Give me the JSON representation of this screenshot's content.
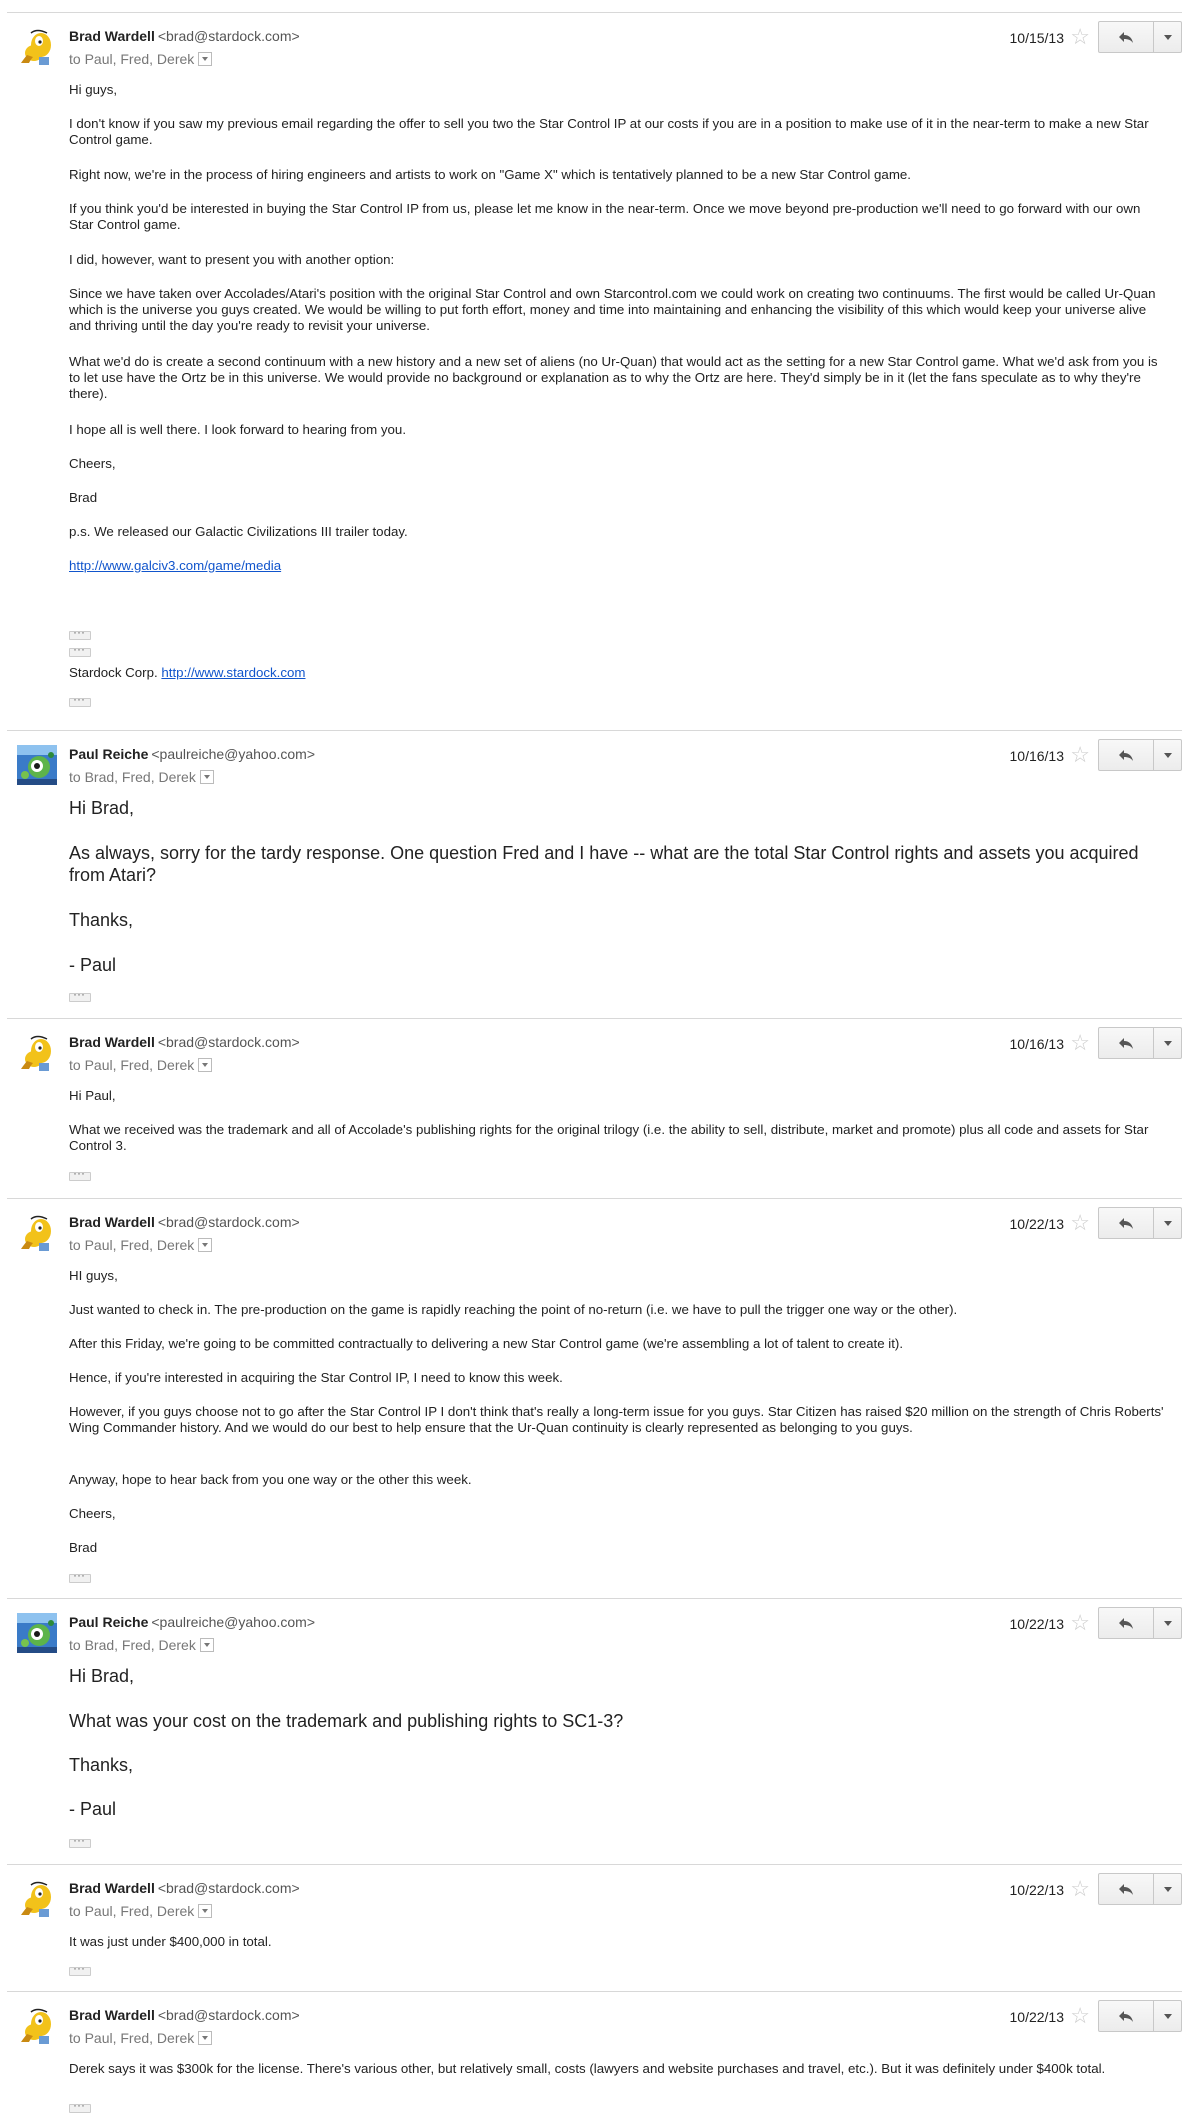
{
  "thread": {
    "messages": [
      {
        "sender": "Brad Wardell",
        "email": "<brad@stardock.com>",
        "to": "to Paul, Fred, Derek",
        "date": "10/15/13",
        "avatar": "yellow-avatar",
        "paragraphs": [
          "Hi guys,",
          "I don't know if you saw my previous email regarding the offer to sell you two the Star Control IP at our costs if you are in a position to make use of it in the near-term to make a new Star Control game.",
          "Right now, we're in the process of hiring engineers and artists to work on \"Game X\" which is tentatively planned to be a new Star Control game.",
          "If you think you'd be interested in buying the Star Control IP from us, please let me know in the near-term.  Once we move beyond pre-production we'll need to go forward with our own Star Control game.",
          "I did, however, want to present you with another option:",
          "Since we have taken over Accolades/Atari's position with the original Star Control and own Starcontrol.com we could work on creating two continuums.  The first would be called Ur-Quan which is the universe you guys created.  We would be willing to put forth effort, money and time into maintaining and enhancing the visibility of this which would keep your universe alive and thriving until the day you're ready to revisit your universe.",
          "What we'd do is create a second continuum with a new history and a new set of aliens (no Ur-Quan) that would act as the setting for a new Star Control game.  What we'd ask from you is to let use have the Ortz be in this universe. We would provide no background or explanation as to why the Ortz are here. They'd simply be in it (let the fans speculate as to why they're there).",
          "I hope all is well there. I look forward to hearing from you.",
          "Cheers,",
          "Brad",
          "p.s. We released our Galactic Civilizations III trailer today."
        ],
        "link": "http://www.galciv3.com/game/media",
        "signature_prefix": "Stardock Corp. ",
        "signature_link": "http://www.stardock.com"
      },
      {
        "sender": "Paul Reiche",
        "email": "<paulreiche@yahoo.com>",
        "to": "to Brad, Fred, Derek",
        "date": "10/16/13",
        "avatar": "green-alien-avatar",
        "paragraphs": [
          "Hi Brad,",
          "As always, sorry for the tardy response.  One question Fred and I have -- what are the total Star Control rights and assets you acquired from Atari?",
          "Thanks,",
          "- Paul"
        ]
      },
      {
        "sender": "Brad Wardell",
        "email": "<brad@stardock.com>",
        "to": "to Paul, Fred, Derek",
        "date": "10/16/13",
        "avatar": "yellow-avatar",
        "paragraphs": [
          "Hi Paul,",
          "What we received was the trademark and all of Accolade's publishing rights for the original trilogy (i.e. the ability to sell, distribute, market and promote) plus all code and assets for Star Control 3."
        ]
      },
      {
        "sender": "Brad Wardell",
        "email": "<brad@stardock.com>",
        "to": "to Paul, Fred, Derek",
        "date": "10/22/13",
        "avatar": "yellow-avatar",
        "paragraphs": [
          "HI guys,",
          "Just wanted to check in.  The pre-production on the game is rapidly reaching the point of no-return (i.e. we have to pull the trigger one way or the other).",
          "After this Friday, we're going to be committed contractually to delivering a new Star Control game (we're assembling a lot of talent to create it).",
          "Hence, if you're interested in acquiring the Star Control IP, I need to know this week.",
          "However, if you guys choose not to go after the Star Control IP I don't think that's really a long-term issue for you guys. Star Citizen has raised $20 million on the strength of Chris Roberts' Wing Commander history.  And we would do our best to help ensure that the Ur-Quan continuity is clearly represented as belonging to you guys.",
          "Anyway, hope to hear back from you one way or the other this week.",
          "Cheers,",
          "Brad"
        ]
      },
      {
        "sender": "Paul Reiche",
        "email": "<paulreiche@yahoo.com>",
        "to": "to Brad, Fred, Derek",
        "date": "10/22/13",
        "avatar": "green-alien-avatar",
        "paragraphs": [
          "Hi Brad,",
          "What was your cost on the trademark and publishing rights to SC1-3?",
          "Thanks,",
          "- Paul"
        ]
      },
      {
        "sender": "Brad Wardell",
        "email": "<brad@stardock.com>",
        "to": "to Paul, Fred, Derek",
        "date": "10/22/13",
        "avatar": "yellow-avatar",
        "paragraphs": [
          "It was just under $400,000 in total."
        ]
      },
      {
        "sender": "Brad Wardell",
        "email": "<brad@stardock.com>",
        "to": "to Paul, Fred, Derek",
        "date": "10/22/13",
        "avatar": "yellow-avatar",
        "paragraphs": [
          "Derek says it was $300k for the license.  There's various other, but relatively small, costs (lawyers and website purchases and travel, etc.). But it was definitely under $400k total."
        ]
      }
    ]
  },
  "icons": {
    "star": "☆",
    "reply": "reply-icon",
    "more": "chevron-down-icon",
    "dots": "show-trimmed-content-icon"
  },
  "colors": {
    "link": "#1155cc",
    "divider": "#d8d8d8",
    "muted_text": "#777777"
  }
}
